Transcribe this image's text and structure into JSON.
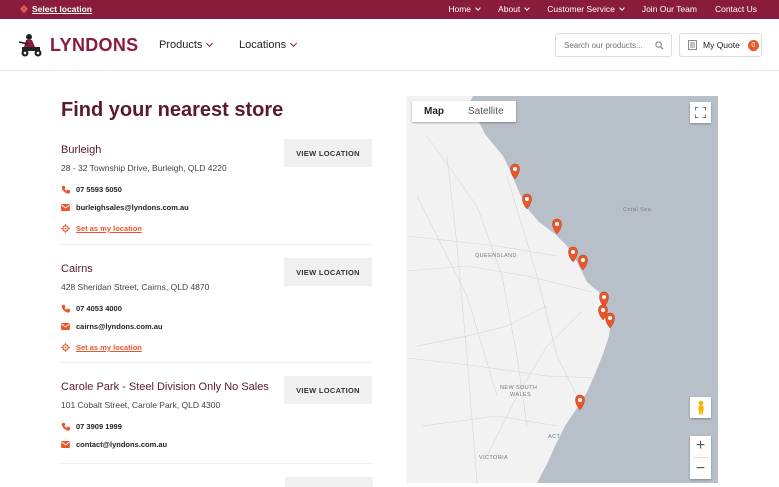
{
  "topbar": {
    "select_location": "Select location",
    "nav": [
      "Home",
      "About",
      "Customer Service",
      "Join Our Team",
      "Contact Us"
    ]
  },
  "header": {
    "logo_text": "LYNDONS",
    "nav": [
      "Products",
      "Locations"
    ],
    "search_placeholder": "Search our products...",
    "quote_label": "My Quote",
    "quote_count": "0"
  },
  "main": {
    "title": "Find your nearest store",
    "view_label": "VIEW LOCATION",
    "set_label": "Set as my location",
    "stores": [
      {
        "name": "Burleigh",
        "address": "28 - 32 Township Drive, Burleigh, QLD 4220",
        "phone": "07 5593 5050",
        "email": "burleighsales@lyndons.com.au"
      },
      {
        "name": "Cairns",
        "address": "428 Sheridan Street, Cairns, QLD 4870",
        "phone": "07 4053 4000",
        "email": "cairns@lyndons.com.au"
      },
      {
        "name": "Carole Park - Steel Division Only No Sales",
        "address": "101 Cobalt Street, Carole Park, QLD 4300",
        "phone": "07 3909 1999",
        "email": "contact@lyndons.com.au"
      }
    ]
  },
  "map": {
    "tabs": [
      "Map",
      "Satellite"
    ],
    "labels": {
      "coral": "Coral Sea",
      "qld": "QUEENSLAND",
      "nsw1": "NEW SOUTH",
      "nsw2": "WALES",
      "act": "ACT",
      "vic": "VICTORIA"
    },
    "zoom_in": "+",
    "zoom_out": "−"
  },
  "colors": {
    "brand": "#8a1c3b",
    "accent": "#e8562a"
  }
}
